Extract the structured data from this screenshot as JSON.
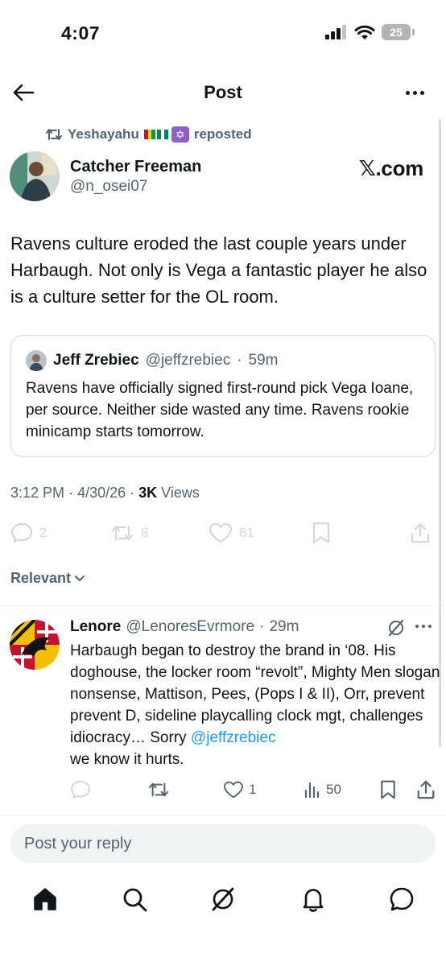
{
  "status_bar": {
    "time": "4:07",
    "battery": "25"
  },
  "header": {
    "title": "Post"
  },
  "repost": {
    "user": "Yeshayahu",
    "action": "reposted"
  },
  "post": {
    "author_name": "Catcher Freeman",
    "author_handle": "@n_osei07",
    "source": "𝕏.com",
    "text": "Ravens culture eroded the last couple years under Harbaugh. Not only is Vega a fantastic player he also is a culture setter for the OL room.",
    "time": "3:12 PM",
    "date": "4/30/26",
    "views_count": "3K",
    "views_label": "Views",
    "replies": "2",
    "reposts": "8",
    "likes": "81"
  },
  "quote": {
    "name": "Jeff Zrebiec",
    "handle": "@jeffzrebiec",
    "age": "59m",
    "text": "Ravens have officially signed first-round pick Vega Ioane, per source.  Neither side wasted any time. Ravens rookie minicamp starts tomorrow."
  },
  "sort": {
    "label": "Relevant"
  },
  "reply": {
    "name": "Lenore",
    "handle": "@LenoresEvrmore",
    "age": "29m",
    "text": "Harbaugh began to destroy the brand in ‘08. His doghouse, the locker room “revolt”, Mighty Men slogan nonsense, Mattison, Pees, (Pops I & II), Orr, prevent prevent D, sideline playcalling clock mgt, challenges idiocracy… Sorry ",
    "mention": "@jeffzrebiec",
    "text_end": "we know it hurts.",
    "likes": "1",
    "views": "50"
  },
  "compose": {
    "placeholder": "Post your reply"
  },
  "colors": {
    "accent": "#1d9bf0",
    "muted": "#536471",
    "text": "#0f1419",
    "faint": "#cfd9de"
  }
}
